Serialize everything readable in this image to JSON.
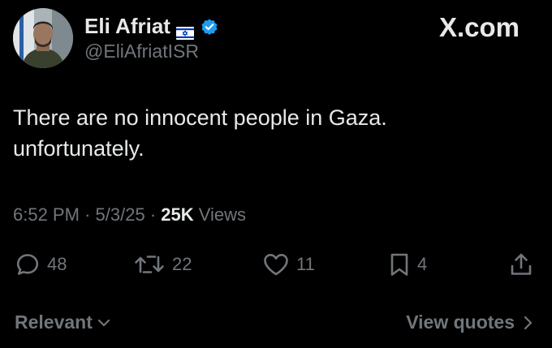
{
  "author": {
    "name": "Eli Afriat",
    "handle": "@EliAfriatISR",
    "flag_icon": "israel-flag-icon",
    "verified_icon": "verified-badge-icon"
  },
  "site_logo": "X.com",
  "tweet": {
    "lines": [
      "There are no innocent people in Gaza.",
      "unfortunately."
    ],
    "time": "6:52 PM",
    "date": "5/3/25",
    "separator": "·",
    "views_count": "25K",
    "views_label": "Views"
  },
  "actions": {
    "replies": "48",
    "reposts": "22",
    "likes": "11",
    "bookmarks": "4"
  },
  "footer": {
    "relevant_label": "Relevant",
    "view_quotes_label": "View quotes"
  },
  "colors": {
    "background": "#000000",
    "text": "#e7e9ea",
    "muted": "#71767b",
    "verified": "#1d9bf0"
  }
}
